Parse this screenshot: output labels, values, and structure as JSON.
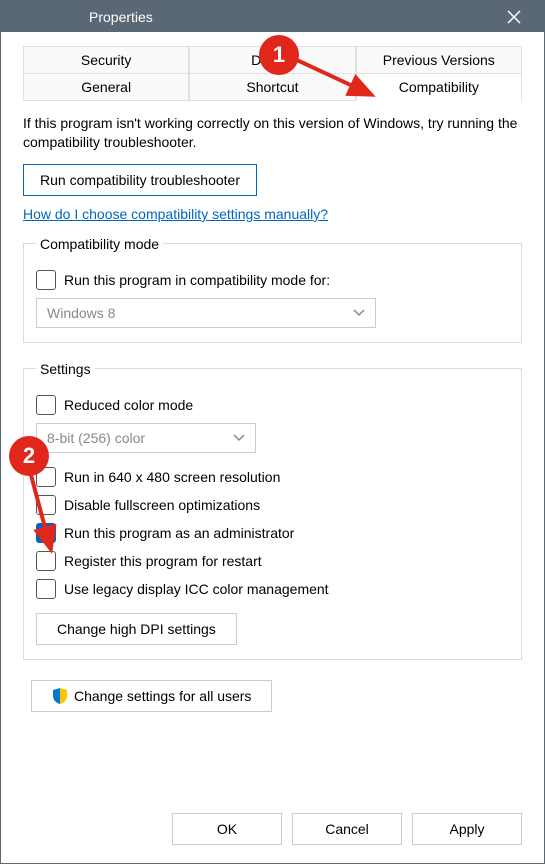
{
  "title": "Properties",
  "tabs": {
    "r1c1": "Security",
    "r1c2": "Details",
    "r1c3": "Previous Versions",
    "r2c1": "General",
    "r2c2": "Shortcut",
    "r2c3": "Compatibility"
  },
  "intro": "If this program isn't working correctly on this version of Windows, try running the compatibility troubleshooter.",
  "run_troubleshooter": "Run compatibility troubleshooter",
  "help_link": "How do I choose compatibility settings manually?",
  "compat_mode": {
    "legend": "Compatibility mode",
    "label": "Run this program in compatibility mode for:",
    "selected": "Windows 8"
  },
  "settings": {
    "legend": "Settings",
    "reduced_color": "Reduced color mode",
    "color_selected": "8-bit (256) color",
    "low_res": "Run in 640 x 480 screen resolution",
    "disable_fs": "Disable fullscreen optimizations",
    "run_admin": "Run this program as an administrator",
    "register_restart": "Register this program for restart",
    "legacy_icc": "Use legacy display ICC color management",
    "high_dpi": "Change high DPI settings"
  },
  "all_users": "Change settings for all users",
  "buttons": {
    "ok": "OK",
    "cancel": "Cancel",
    "apply": "Apply"
  },
  "annotations": {
    "b1": "1",
    "b2": "2"
  }
}
